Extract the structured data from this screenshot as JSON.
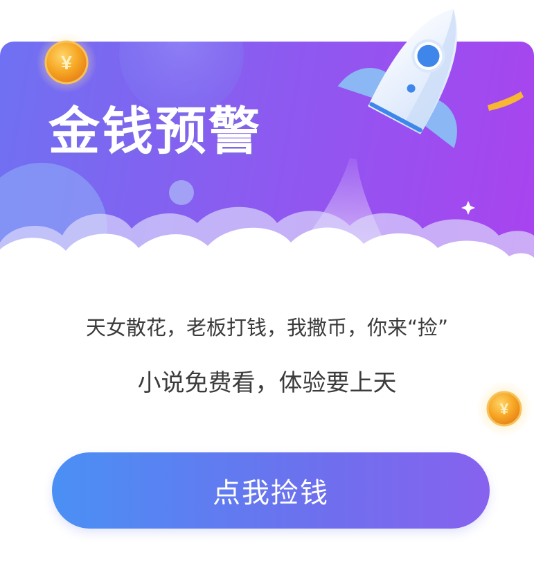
{
  "popup": {
    "headline": "金钱预警",
    "line1": "天女散花，老板打钱，我撒币，你来“捡”",
    "line2": "小说免费看，体验要上天",
    "cta_label": "点我捡钱"
  },
  "icons": [
    "rocket-icon",
    "gold-coin-icon",
    "cloud-shape",
    "sparkle-star-icon",
    "confetti-ribbon"
  ],
  "colors": {
    "banner_gradient_start": "#6f71f2",
    "banner_gradient_end": "#a943ef",
    "button_gradient_start": "#4a90f4",
    "button_gradient_end": "#8762ee",
    "body_text": "#3b3b3b",
    "coin": "#f5a623"
  }
}
